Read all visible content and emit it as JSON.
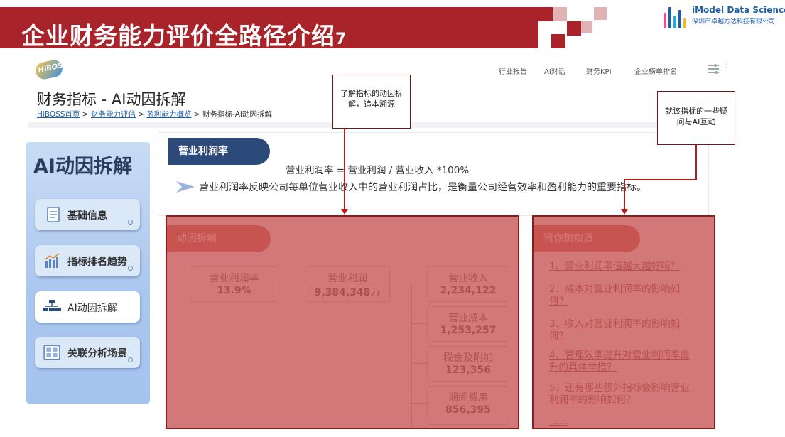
{
  "slide": {
    "title": "企业财务能力评价全路径介绍",
    "title_suffix": "7",
    "brand_name": "iModel Data Science",
    "brand_sub": "深圳市卓越方达科技有限公司",
    "accent_color": "#a8232a"
  },
  "app": {
    "logo": "HiBOSS",
    "nav": [
      "行业报告",
      "AI对话",
      "财务KPI",
      "企业榜单排名"
    ],
    "more": "⋮",
    "page_title": "财务指标 - AI动因拆解",
    "breadcrumb": {
      "home": "HiBOSS首页",
      "sep": ">",
      "level1": "财务能力评估",
      "level2": "盈利能力概览",
      "current": "财务指标-AI动因拆解"
    }
  },
  "sidebar": {
    "title": "AI动因拆解",
    "items": [
      {
        "label": "基础信息",
        "icon": "document-icon"
      },
      {
        "label": "指标排名趋势",
        "icon": "bar-chart-icon"
      },
      {
        "label": "AI动因拆解",
        "icon": "org-tree-icon",
        "active": true
      },
      {
        "label": "关联分析场景",
        "icon": "dashboard-icon"
      }
    ]
  },
  "metric": {
    "tab": "营业利润率",
    "formula": "营业利润率 = 营业利润 / 营业收入 *100%",
    "description": "营业利润率反映公司每单位营业收入中的营业利润占比，是衡量公司经营效率和盈利能力的重要指标。"
  },
  "breakdown": {
    "tab": "动因拆解",
    "root": {
      "name": "营业利润率",
      "value": "13.9%"
    },
    "mid": {
      "name": "营业利润",
      "value": "9,384,348",
      "unit": "万"
    },
    "leaves": [
      {
        "name": "营业收入",
        "value": "2,234,122"
      },
      {
        "name": "营业成本",
        "value": "1,253,257"
      },
      {
        "name": "税金及附加",
        "value": "123,356"
      },
      {
        "name": "期间费用",
        "value": "856,395"
      }
    ]
  },
  "questions": {
    "tab": "猜你想知道",
    "items": [
      "1、营业利润率值越大越好吗？",
      "2、成本对营业利润率的影响如何？",
      "3、收入对营业利润率的影响如何？",
      "4、管理效率提升对营业利润率提升的具体举措？",
      "5、还有哪些额外指标会影响营业利润率的影响如何？"
    ],
    "ellipsis": "……"
  },
  "callouts": {
    "left": "了解指标的动因拆解，追本溯源",
    "right": "就该指标的一些疑问与AI互动"
  }
}
